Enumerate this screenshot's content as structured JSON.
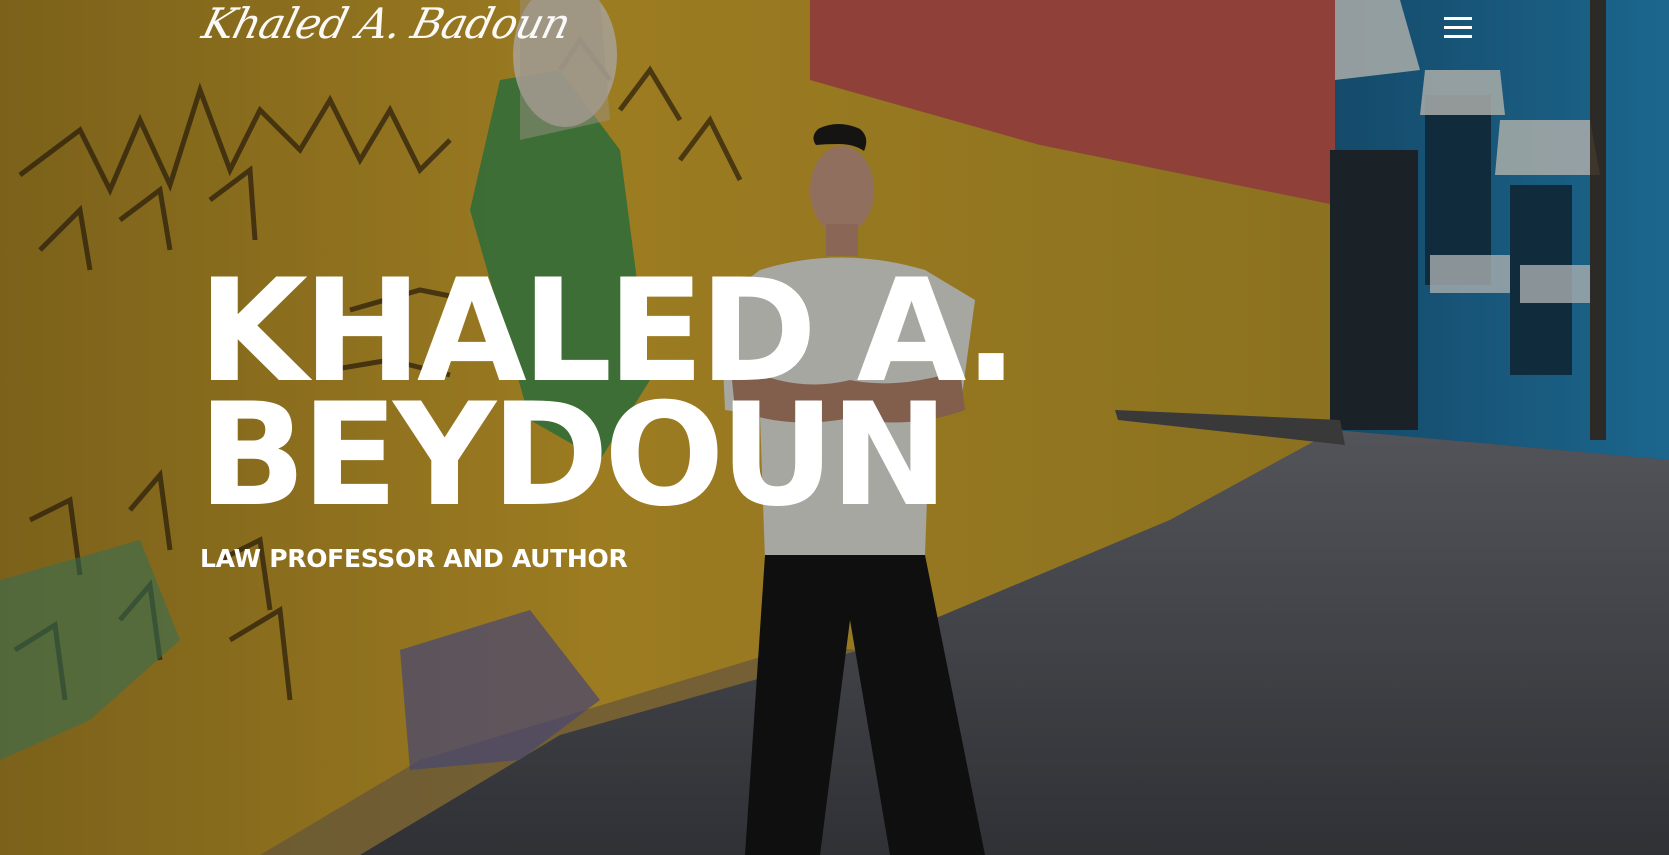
{
  "header": {
    "logo_text": "Khaled A. Badoun",
    "menu_icon": "hamburger-menu-icon"
  },
  "hero": {
    "title_line_1": "KHALED A.",
    "title_line_2": "BEYDOUN",
    "subtitle": "LAW PROFESSOR AND AUTHOR",
    "background_description_colors": {
      "yellow_wall": "#d8ad2d",
      "red_stripe": "#b84e43",
      "blue_building": "#1d6f9d",
      "cobblestone": "#56585f"
    }
  }
}
